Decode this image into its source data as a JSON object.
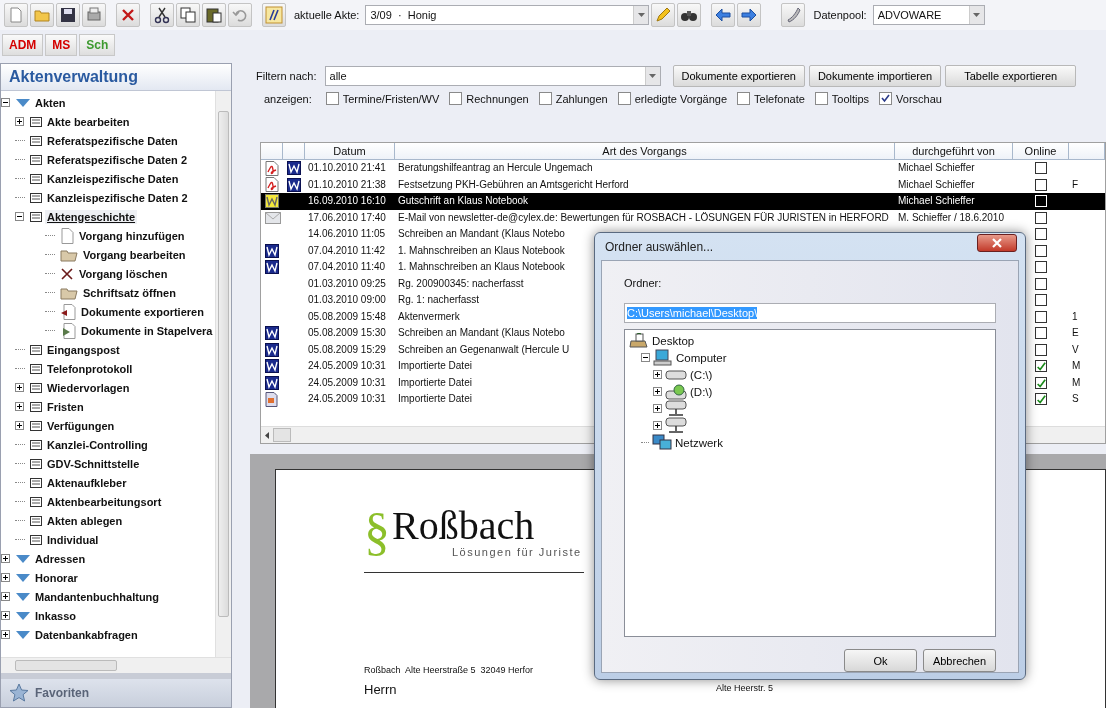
{
  "toolbar": {
    "file_label": "aktuelle Akte:",
    "file_value": "3/09  ·  Honig",
    "pool_label": "Datenpool:",
    "pool_value": "ADVOWARE"
  },
  "user_buttons": [
    {
      "label": "ADM",
      "color": "#d40000"
    },
    {
      "label": "MS",
      "color": "#d40000"
    },
    {
      "label": "Sch",
      "color": "#3d9a2f"
    }
  ],
  "sidebar": {
    "title": "Aktenverwaltung",
    "favorites": "Favoriten",
    "tree": [
      {
        "label": "Akten",
        "kind": "group",
        "expanded": true,
        "selected": false,
        "children": [
          {
            "label": "Akte bearbeiten",
            "kind": "page",
            "expanded": false,
            "selected": false
          },
          {
            "label": "Referatspezifische Daten",
            "kind": "page",
            "selected": false
          },
          {
            "label": "Referatspezifische Daten 2",
            "kind": "page",
            "selected": false
          },
          {
            "label": "Kanzleispezifische Daten",
            "kind": "page",
            "selected": false
          },
          {
            "label": "Kanzleispezifische Daten 2",
            "kind": "page",
            "selected": false
          },
          {
            "label": "Aktengeschichte",
            "kind": "page",
            "expanded": true,
            "selected": true,
            "children": [
              {
                "label": "Vorgang hinzufügen",
                "kind": "new",
                "selected": false
              },
              {
                "label": "Vorgang bearbeiten",
                "kind": "edit",
                "selected": false
              },
              {
                "label": "Vorgang löschen",
                "kind": "delete",
                "selected": false
              },
              {
                "label": "Schriftsatz öffnen",
                "kind": "open",
                "selected": false
              },
              {
                "label": "Dokumente exportieren",
                "kind": "export",
                "selected": false
              },
              {
                "label": "Dokumente in Stapelvera",
                "kind": "batch",
                "selected": false
              }
            ]
          },
          {
            "label": "Eingangspost",
            "kind": "page",
            "selected": false
          },
          {
            "label": "Telefonprotokoll",
            "kind": "page",
            "selected": false
          },
          {
            "label": "Wiedervorlagen",
            "kind": "page",
            "expanded": false,
            "selected": false
          },
          {
            "label": "Fristen",
            "kind": "page",
            "expanded": false,
            "selected": false
          },
          {
            "label": "Verfügungen",
            "kind": "page",
            "expanded": false,
            "selected": false
          },
          {
            "label": "Kanzlei-Controlling",
            "kind": "page",
            "selected": false
          },
          {
            "label": "GDV-Schnittstelle",
            "kind": "page",
            "selected": false
          },
          {
            "label": "Aktenaufkleber",
            "kind": "page",
            "selected": false
          },
          {
            "label": "Aktenbearbeitungsort",
            "kind": "page",
            "selected": false
          },
          {
            "label": "Akten ablegen",
            "kind": "page",
            "selected": false
          },
          {
            "label": "Individual",
            "kind": "page",
            "selected": false
          }
        ]
      },
      {
        "label": "Adressen",
        "kind": "group",
        "expanded": false,
        "selected": false
      },
      {
        "label": "Honorar",
        "kind": "group",
        "expanded": false,
        "selected": false
      },
      {
        "label": "Mandantenbuchhaltung",
        "kind": "group",
        "expanded": false,
        "selected": false
      },
      {
        "label": "Inkasso",
        "kind": "group",
        "expanded": false,
        "selected": false
      },
      {
        "label": "Datenbankabfragen",
        "kind": "group",
        "expanded": false,
        "selected": false
      }
    ]
  },
  "filter": {
    "label": "Filtern nach:",
    "value": "alle",
    "buttons": [
      "Dokumente exportieren",
      "Dokumente importieren",
      "Tabelle exportieren"
    ],
    "show_label": "anzeigen:",
    "options": [
      {
        "label": "Termine/Fristen/WV",
        "checked": false
      },
      {
        "label": "Rechnungen",
        "checked": false
      },
      {
        "label": "Zahlungen",
        "checked": false
      },
      {
        "label": "erledigte Vorgänge",
        "checked": false
      },
      {
        "label": "Telefonate",
        "checked": false
      },
      {
        "label": "Tooltips",
        "checked": false
      },
      {
        "label": "Vorschau",
        "checked": true
      }
    ]
  },
  "table": {
    "columns": [
      "Datum",
      "Art des Vorgangs",
      "durchgeführt von",
      "Online"
    ],
    "rows": [
      {
        "kind": "pdf",
        "date": "01.10.2010 21:41",
        "type": "Beratungshilfeantrag an Hercule Ungemach",
        "by": "Michael Schieffer",
        "online": false,
        "selected": false
      },
      {
        "kind": "pdf",
        "date": "01.10.2010 21:38",
        "type": "Festsetzung PKH-Gebühren an Amtsgericht Herford",
        "by": "Michael Schieffer",
        "online": false,
        "column_6": "F",
        "selected": false
      },
      {
        "kind": "word",
        "date": "16.09.2010 16:10",
        "type": "Gutschrift an Klaus Notebook",
        "by": "Michael Schieffer",
        "online": false,
        "selected": true
      },
      {
        "kind": "mail",
        "date": "17.06.2010 17:40",
        "type": "E-Mail von newsletter-de@cylex.de: Bewertungen für ROSBACH - LÖSUNGEN FÜR JURISTEN in HERFORD",
        "by": "M. Schieffer / 18.6.2010",
        "online": false,
        "selected": false
      },
      {
        "kind": "plain",
        "date": "14.06.2010 11:05",
        "type": "Schreiben an Mandant (Klaus Notebo",
        "online": false,
        "selected": false
      },
      {
        "kind": "word",
        "date": "07.04.2010 11:42",
        "type": "1. Mahnschreiben an Klaus Notebook",
        "online": false,
        "selected": false
      },
      {
        "kind": "word",
        "date": "07.04.2010 11:40",
        "type": "1. Mahnschreiben an Klaus Notebook",
        "online": false,
        "selected": false
      },
      {
        "kind": "plain",
        "date": "01.03.2010 09:25",
        "type": "Rg. 200900345: nacherfasst",
        "online": false,
        "selected": false
      },
      {
        "kind": "plain",
        "date": "01.03.2010 09:00",
        "type": "Rg. 1: nacherfasst",
        "online": false,
        "selected": false
      },
      {
        "kind": "plain",
        "date": "05.08.2009 15:48",
        "type": "Aktenvermerk",
        "online": false,
        "column_6": "1",
        "selected": false
      },
      {
        "kind": "word",
        "date": "05.08.2009 15:30",
        "type": "Schreiben an Mandant (Klaus Notebo",
        "online": false,
        "column_6": "E",
        "selected": false
      },
      {
        "kind": "word",
        "date": "05.08.2009 15:29",
        "type": "Schreiben an Gegenanwalt (Hercule U",
        "online": false,
        "column_6": "V",
        "selected": false
      },
      {
        "kind": "word",
        "date": "24.05.2009 10:31",
        "type": "Importierte Datei",
        "online": true,
        "column_6": "M",
        "selected": false
      },
      {
        "kind": "word",
        "date": "24.05.2009 10:31",
        "type": "Importierte Datei",
        "online": true,
        "column_6": "M",
        "selected": false
      },
      {
        "kind": "image",
        "date": "24.05.2009 10:31",
        "type": "Importierte Datei",
        "online": true,
        "column_6": "S",
        "selected": false
      }
    ]
  },
  "preview": {
    "logo_mark": "§",
    "logo_name": "Roßbach",
    "logo_tagline": "Lösungen für Juriste",
    "sender_line": "Roßbach  Alte Heerstraße 5  32049 Herfor",
    "recipient_line": "Herrn",
    "right_line": "Alte Heerstr. 5"
  },
  "dialog": {
    "title": "Ordner auswählen...",
    "folder_label": "Ordner:",
    "folder_value": "C:\\Users\\michael\\Desktop\\",
    "tree": [
      {
        "label": "Desktop",
        "kind": "desktop",
        "children": [
          {
            "label": "Computer",
            "kind": "computer",
            "expanded": true,
            "children": [
              {
                "label": "(C:\\)",
                "kind": "disk",
                "expanded": false
              },
              {
                "label": "(D:\\)",
                "kind": "cdrom",
                "expanded": false
              },
              {
                "kind": "netdrive",
                "expanded": false
              },
              {
                "kind": "netdrive",
                "expanded": false
              }
            ]
          },
          {
            "label": "Netzwerk",
            "kind": "network"
          }
        ]
      }
    ],
    "buttons": [
      "Ok",
      "Abbrechen"
    ]
  }
}
